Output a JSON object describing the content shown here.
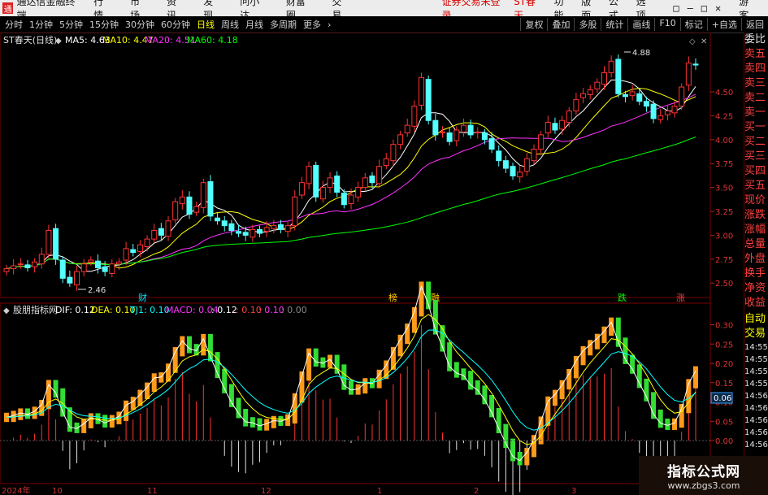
{
  "menubar": {
    "logo_glyph": "通",
    "app_title": "通达信金融终端",
    "items": [
      "行情",
      "市场",
      "资讯",
      "发现",
      "问小达",
      "财富圈",
      "交易"
    ],
    "login_alert": "证券交易未登录",
    "stock_name": "ST春天",
    "right_items": [
      "功能",
      "版面",
      "公式",
      "选项"
    ],
    "window_controls": [
      "□",
      "—",
      "□",
      "✕"
    ],
    "guest": "游客"
  },
  "periodbar": {
    "periods": [
      "分时",
      "1分钟",
      "5分钟",
      "15分钟",
      "30分钟",
      "60分钟",
      "日线",
      "周线",
      "月线",
      "多周期",
      "更多"
    ],
    "active": "日线",
    "tools": [
      "复权",
      "叠加",
      "多股",
      "统计",
      "画线",
      "F10",
      "标记",
      "+自选",
      "返回"
    ]
  },
  "main_panel": {
    "title": "ST春天(日线)",
    "indicators": [
      {
        "label": "MA5: 4.63",
        "color": "#ffffff"
      },
      {
        "label": "MA10: 4.47",
        "color": "#ffff00"
      },
      {
        "label": "MA20: 4.51",
        "color": "#ff33ff"
      },
      {
        "label": "MA60: 4.18",
        "color": "#00ff00"
      }
    ],
    "high_label": "4.88",
    "low_label": "2.46",
    "event_markers": [
      {
        "text": "财",
        "color": "#00e0ff"
      },
      {
        "text": "榜",
        "color": "#ffcc00"
      },
      {
        "text": "融",
        "color": "#ffcc00"
      },
      {
        "text": "跌",
        "color": "#00ff00"
      },
      {
        "text": "涨",
        "color": "#ff4040"
      }
    ],
    "y_ticks": [
      "4.50",
      "4.25",
      "4.00",
      "3.75",
      "3.50",
      "3.25",
      "3.00",
      "2.75",
      "2.50"
    ]
  },
  "sub_panel": {
    "title": "股朋指标网",
    "indicators": [
      {
        "label": "DIF: 0.12",
        "color": "#ffffff"
      },
      {
        "label": "DEA: 0.10",
        "color": "#ffff00"
      },
      {
        "label": "TJ1: 0.10",
        "color": "#00ffff"
      },
      {
        "label": "MACD: 0.04",
        "color": "#ff33ff"
      },
      {
        "label": ": 0.12",
        "color": "#ffffff"
      },
      {
        "label": ": 0.10",
        "color": "#ff4040"
      },
      {
        "label": ": 0.10",
        "color": "#ff33ff"
      },
      {
        "label": ": 0.00",
        "color": "#888888"
      }
    ],
    "y_ticks": [
      "0.30",
      "0.25",
      "0.20",
      "0.15",
      "0.10",
      "0.05",
      "0.00"
    ],
    "value_tag": "0.06"
  },
  "x_axis": [
    "2024年",
    "10",
    "11",
    "12",
    "1",
    "2",
    "3"
  ],
  "sidebar": {
    "top_items": [
      "委比",
      "卖五",
      "卖四",
      "卖三",
      "卖二",
      "卖一",
      "买一",
      "买二",
      "买三",
      "买四",
      "买五",
      "现价",
      "涨跌",
      "涨幅",
      "总量",
      "外盘",
      "换手",
      "净资",
      "收益"
    ],
    "bottom_items": [
      "自动",
      "交易"
    ],
    "times": [
      "14:55",
      "14:55",
      "14:55",
      "14:55",
      "14:56",
      "14:56",
      "14:56",
      "14:56",
      "14:56"
    ]
  },
  "watermark": {
    "title": "指标公式网",
    "url": "www.zbgs3.com"
  },
  "colors": {
    "up": "#ff3232",
    "down": "#54ffff",
    "ma5": "#ffffff",
    "ma10": "#ffff00",
    "ma20": "#ff33ff",
    "ma60": "#00ff00"
  },
  "series": {
    "closes": [
      2.65,
      2.68,
      2.7,
      2.66,
      2.72,
      2.8,
      3.05,
      2.75,
      2.55,
      2.5,
      2.62,
      2.7,
      2.74,
      2.66,
      2.62,
      2.7,
      2.72,
      2.86,
      2.82,
      2.9,
      2.96,
      3.05,
      3.0,
      3.15,
      3.35,
      3.4,
      3.22,
      3.3,
      3.55,
      3.2,
      3.15,
      3.1,
      3.05,
      3.02,
      3.0,
      3.06,
      3.02,
      3.08,
      3.1,
      3.06,
      3.1,
      3.4,
      3.55,
      3.72,
      3.4,
      3.5,
      3.6,
      3.45,
      3.32,
      3.42,
      3.5,
      3.6,
      3.55,
      3.72,
      3.8,
      3.95,
      4.05,
      4.15,
      4.35,
      4.65,
      4.2,
      4.05,
      4.08,
      3.98,
      4.1,
      4.15,
      4.05,
      4.08,
      4.0,
      3.9,
      3.78,
      3.7,
      3.62,
      3.66,
      3.8,
      3.9,
      4.05,
      4.18,
      4.1,
      4.2,
      4.3,
      4.42,
      4.48,
      4.52,
      4.6,
      4.7,
      4.82,
      4.48,
      4.45,
      4.5,
      4.4,
      4.35,
      4.22,
      4.25,
      4.3,
      4.35,
      4.55,
      4.8,
      4.78
    ]
  }
}
